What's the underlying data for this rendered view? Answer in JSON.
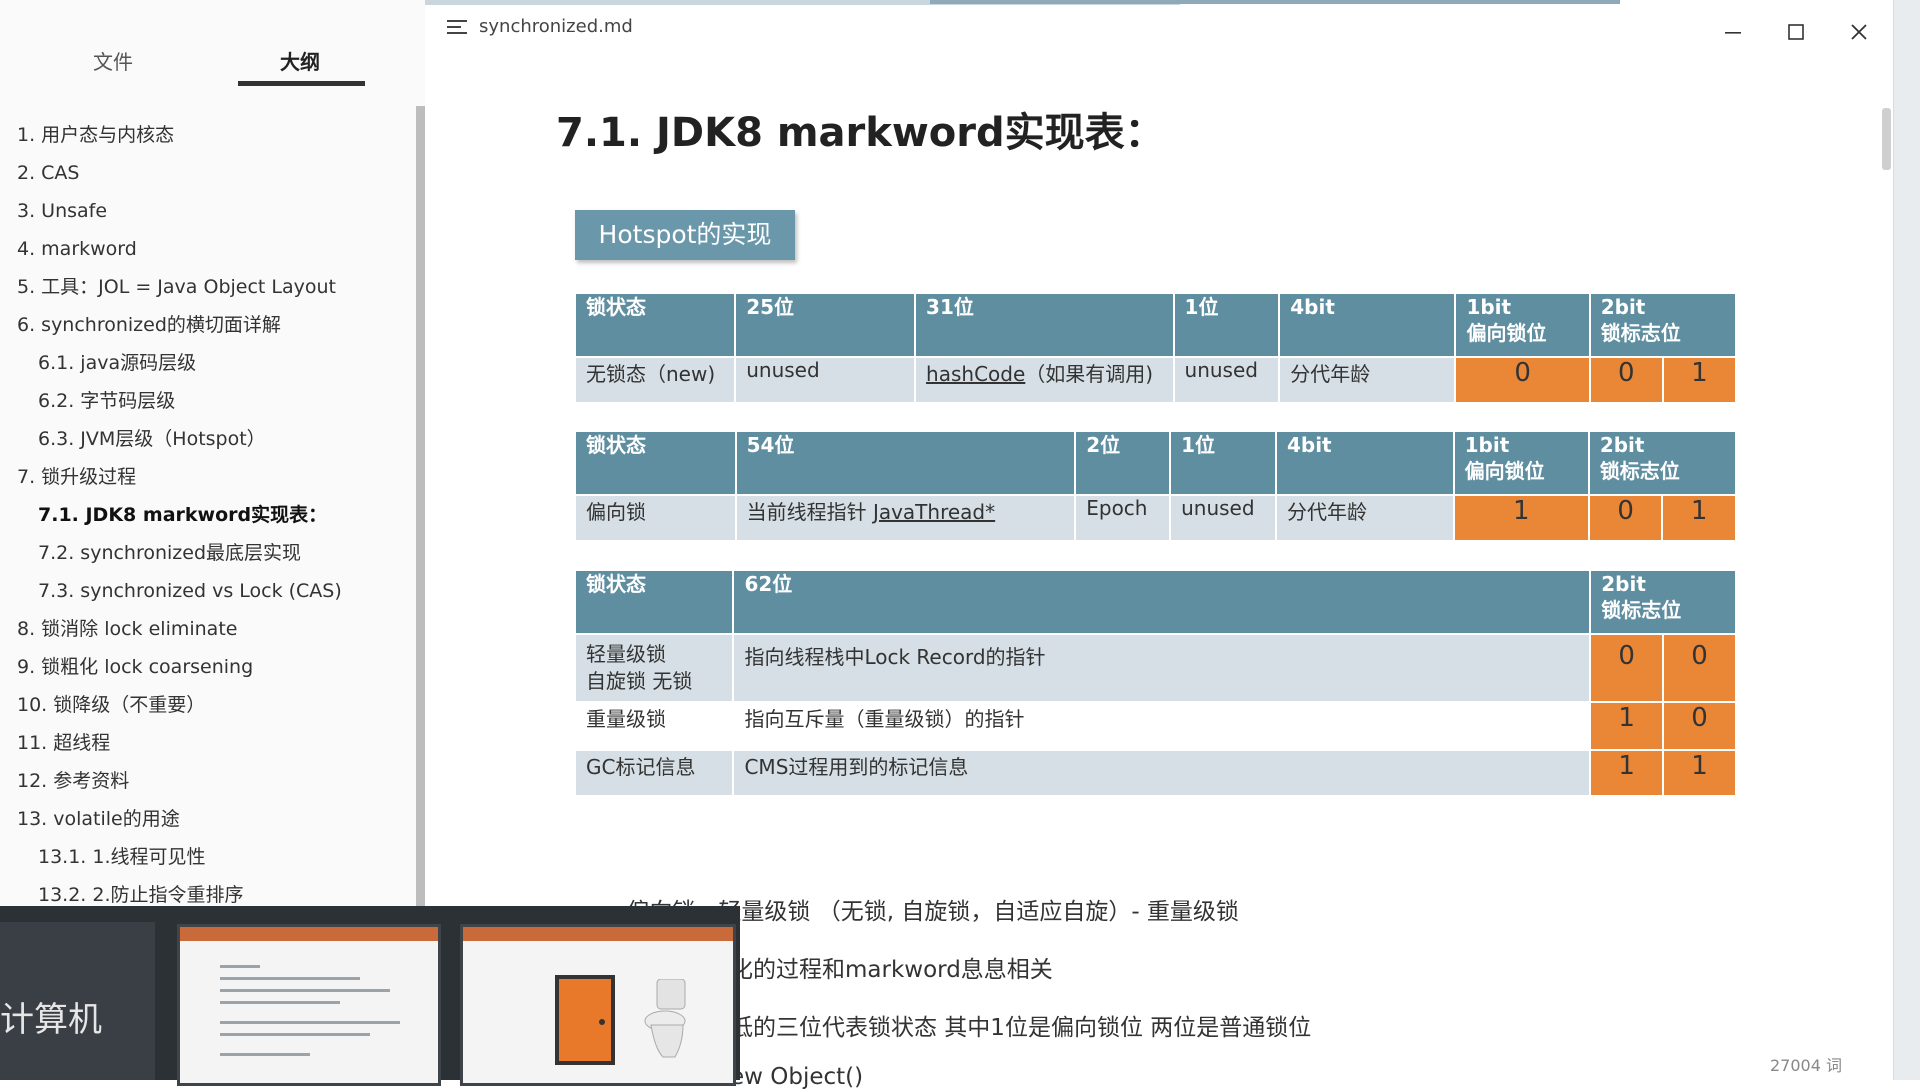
{
  "window": {
    "doc_name": "synchronized.md",
    "minimize_glyph": "—",
    "maximize_glyph": "☐",
    "close_glyph": "✕"
  },
  "sidebar": {
    "tabs": [
      {
        "label": "文件"
      },
      {
        "label": "大纲",
        "active": true
      }
    ],
    "outline": [
      {
        "label": "1. 用户态与内核态",
        "level": 1
      },
      {
        "label": "2. CAS",
        "level": 1
      },
      {
        "label": "3. Unsafe",
        "level": 1
      },
      {
        "label": "4. markword",
        "level": 1
      },
      {
        "label": "5. 工具：JOL = Java Object Layout",
        "level": 1
      },
      {
        "label": "6. synchronized的横切面详解",
        "level": 1
      },
      {
        "label": "6.1. java源码层级",
        "level": 2
      },
      {
        "label": "6.2. 字节码层级",
        "level": 2
      },
      {
        "label": "6.3. JVM层级（Hotspot）",
        "level": 2
      },
      {
        "label": "7. 锁升级过程",
        "level": 1
      },
      {
        "label": "7.1. JDK8 markword实现表：",
        "level": 2,
        "active": true
      },
      {
        "label": "7.2. synchronized最底层实现",
        "level": 2
      },
      {
        "label": "7.3. synchronized vs Lock (CAS)",
        "level": 2
      },
      {
        "label": "8. 锁消除 lock eliminate",
        "level": 1
      },
      {
        "label": "9. 锁粗化 lock coarsening",
        "level": 1
      },
      {
        "label": "10. 锁降级（不重要）",
        "level": 1
      },
      {
        "label": "11. 超线程",
        "level": 1
      },
      {
        "label": "12. 参考资料",
        "level": 1
      },
      {
        "label": "13. volatile的用途",
        "level": 1
      },
      {
        "label": "13.1. 1.线程可见性",
        "level": 2
      },
      {
        "label": "13.2. 2.防止指令重排序",
        "level": 2
      }
    ]
  },
  "content": {
    "heading": "7.1. JDK8 markword实现表：",
    "hotspot_label": "Hotspot的实现",
    "table1": {
      "headers": [
        "锁状态",
        "25位",
        "31位",
        "1位",
        "4bit",
        "1bit",
        "偏向锁位",
        "2bit",
        "锁标志位"
      ],
      "row": [
        "无锁态（new)",
        "unused",
        "hashCode",
        "（如果有调用)",
        "unused",
        "分代年龄",
        "0",
        "0",
        "1"
      ]
    },
    "table2": {
      "headers": [
        "锁状态",
        "54位",
        "2位",
        "1位",
        "4bit",
        "1bit",
        "偏向锁位",
        "2bit",
        "锁标志位"
      ],
      "row": [
        "偏向锁",
        "当前线程指针 ",
        "JavaThread*",
        "Epoch",
        "unused",
        "分代年龄",
        "1",
        "0",
        "1"
      ]
    },
    "table3": {
      "headers": [
        "锁状态",
        "62位",
        "2bit",
        "锁标志位"
      ],
      "rows": [
        {
          "state": "轻量级锁",
          "state2": "自旋锁 无锁",
          "desc": "指向线程栈中Lock Record的指针",
          "b1": "0",
          "b2": "0"
        },
        {
          "state": "重量级锁",
          "desc": "指向互斥量（重量级锁）的指针",
          "b1": "1",
          "b2": "0"
        },
        {
          "state": "GC标记信息",
          "desc": "CMS过程用到的标记信息",
          "b1": "1",
          "b2": "1"
        }
      ]
    },
    "paragraphs": [
      "new - 偏向锁 - 轻量级锁 （无锁, 自旋锁，自适应自旋）- 重量级锁",
      "化的过程和markword息息相关",
      "低的三位代表锁状态 其中1位是偏向锁位 两位是普通锁位",
      "ew Object()"
    ],
    "word_count": "27004 词"
  },
  "taskbar": {
    "app_label": "计算机"
  }
}
